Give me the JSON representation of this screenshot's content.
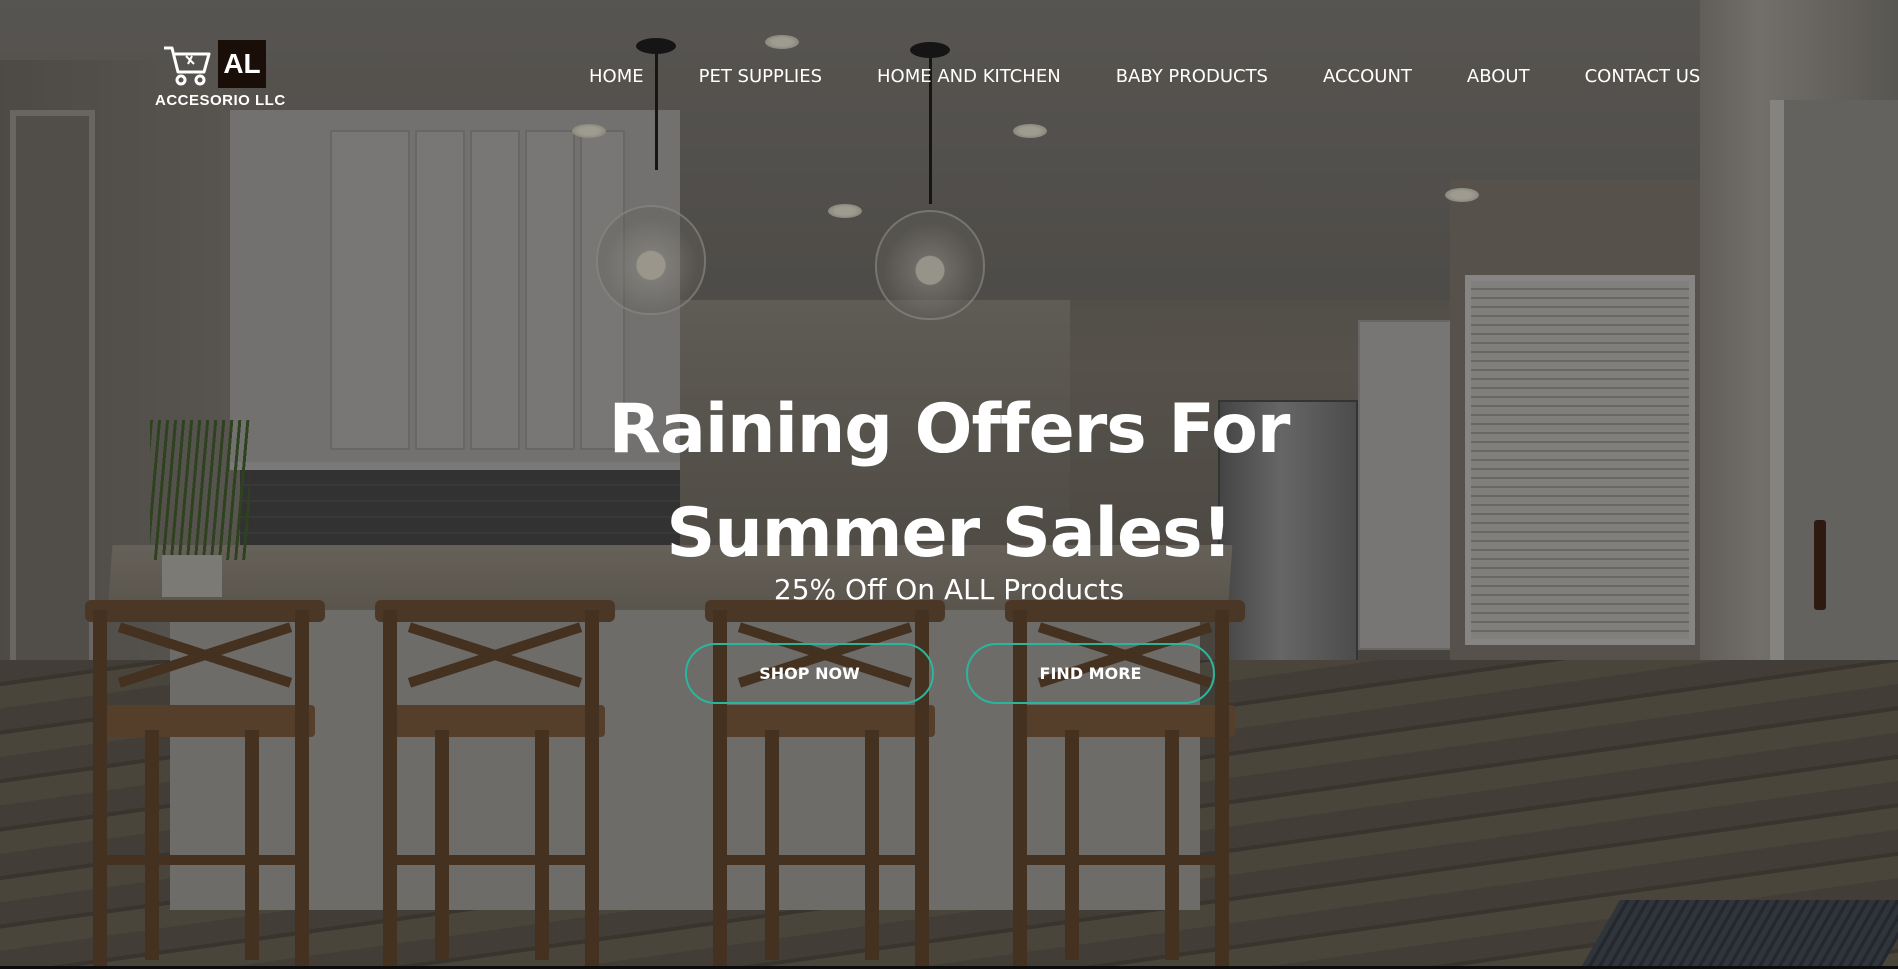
{
  "brand": {
    "logo_mark": "AL",
    "name": "ACCESORIO LLC",
    "icon": "shopping-cart-icon"
  },
  "nav": {
    "items": [
      {
        "label": "HOME"
      },
      {
        "label": "PET SUPPLIES"
      },
      {
        "label": "HOME AND KITCHEN"
      },
      {
        "label": "BABY PRODUCTS"
      },
      {
        "label": "ACCOUNT"
      },
      {
        "label": "ABOUT"
      },
      {
        "label": "CONTACT US"
      }
    ]
  },
  "hero": {
    "title_line1": "Raining Offers For",
    "title_line2": "Summer Sales!",
    "subtitle": "25% Off On ALL Products",
    "primary_button": "SHOP NOW",
    "secondary_button": "FIND MORE",
    "accent_color": "#2bb59a"
  }
}
